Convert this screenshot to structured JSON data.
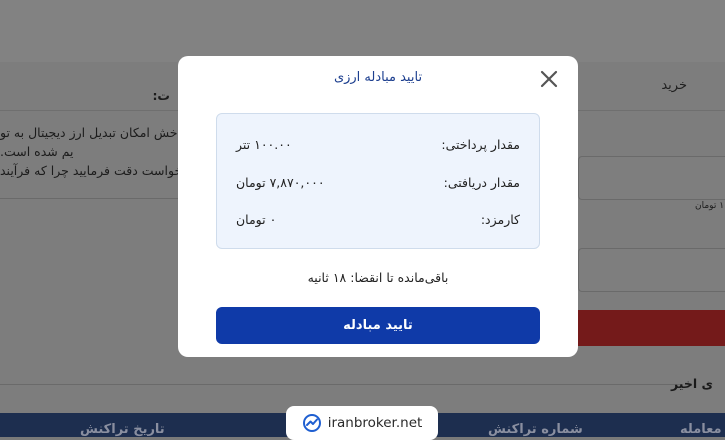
{
  "background": {
    "tab_buy": "خرید",
    "heading_fragment": "ت:",
    "paragraph_lines": [
      "خش امکان تبدیل ارز دیجیتال به تو",
      "یم شده است.",
      "درخواست دقت فرمایید چرا که فرآیند"
    ],
    "input_hint": "۱ تومان",
    "recent_section": "ی اخیر",
    "table_headers": [
      "ع معامله",
      "شماره تراکنش",
      "تاریخ تراکنش"
    ]
  },
  "modal": {
    "title": "تایید مبادله ارزی",
    "rows": [
      {
        "label": "مقدار پرداختی:",
        "value": "۱۰۰.۰۰ تتر"
      },
      {
        "label": "مقدار دریافتی:",
        "value": "۷,۸۷۰,۰۰۰ تومان"
      },
      {
        "label": "کارمزد:",
        "value": "۰ تومان"
      }
    ],
    "countdown": "باقی‌مانده تا انقضا: ۱۸ ثانیه",
    "confirm_label": "تایید مبادله"
  },
  "watermark": {
    "text": "iranbroker.net"
  },
  "colors": {
    "accent": "#0f3aa8",
    "title": "#1d3f8f",
    "info_box_bg": "#eef4fd",
    "table_header": "#1d2e4f"
  },
  "icons": {
    "close": "close-icon",
    "logo": "iranbroker-logo-icon"
  }
}
